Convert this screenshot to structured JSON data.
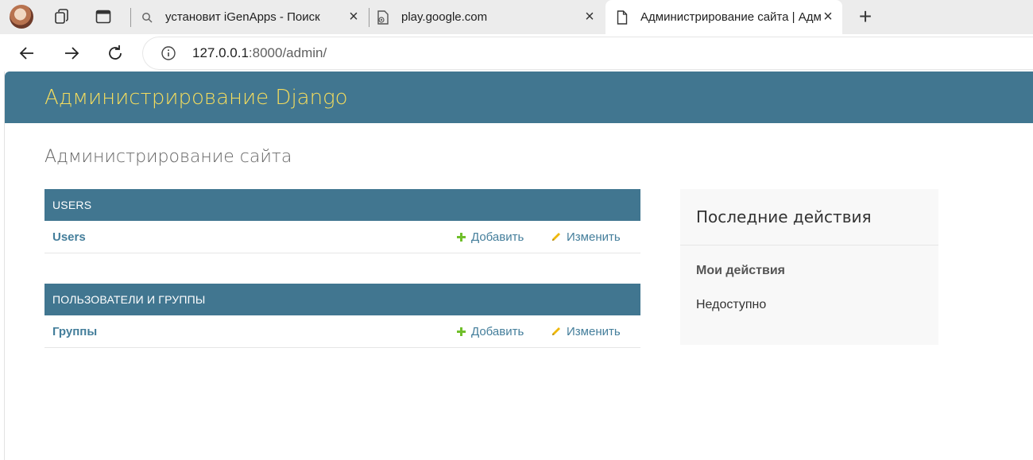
{
  "browser": {
    "tabs": [
      {
        "label": "установит iGenApps - Поиск",
        "icon": "search-icon"
      },
      {
        "label": "play.google.com",
        "icon": "broken-page-icon"
      },
      {
        "label": "Администрирование сайта | Адм",
        "icon": "page-icon",
        "active": true
      }
    ],
    "address": {
      "host": "127.0.0.1",
      "rest": ":8000/admin/"
    }
  },
  "header": {
    "branding": "Администрирование Django",
    "color": "#417690",
    "branding_color": "#f5dd5d"
  },
  "content": {
    "title": "Администрирование сайта",
    "modules": [
      {
        "caption": "USERS",
        "rows": [
          {
            "model": "Users",
            "add": "Добавить",
            "change": "Изменить"
          }
        ]
      },
      {
        "caption": "ПОЛЬЗОВАТЕЛИ И ГРУППЫ",
        "rows": [
          {
            "model": "Группы",
            "add": "Добавить",
            "change": "Изменить"
          }
        ]
      }
    ]
  },
  "recent_actions": {
    "title": "Последние действия",
    "subtitle": "Мои действия",
    "empty_text": "Недоступно"
  }
}
